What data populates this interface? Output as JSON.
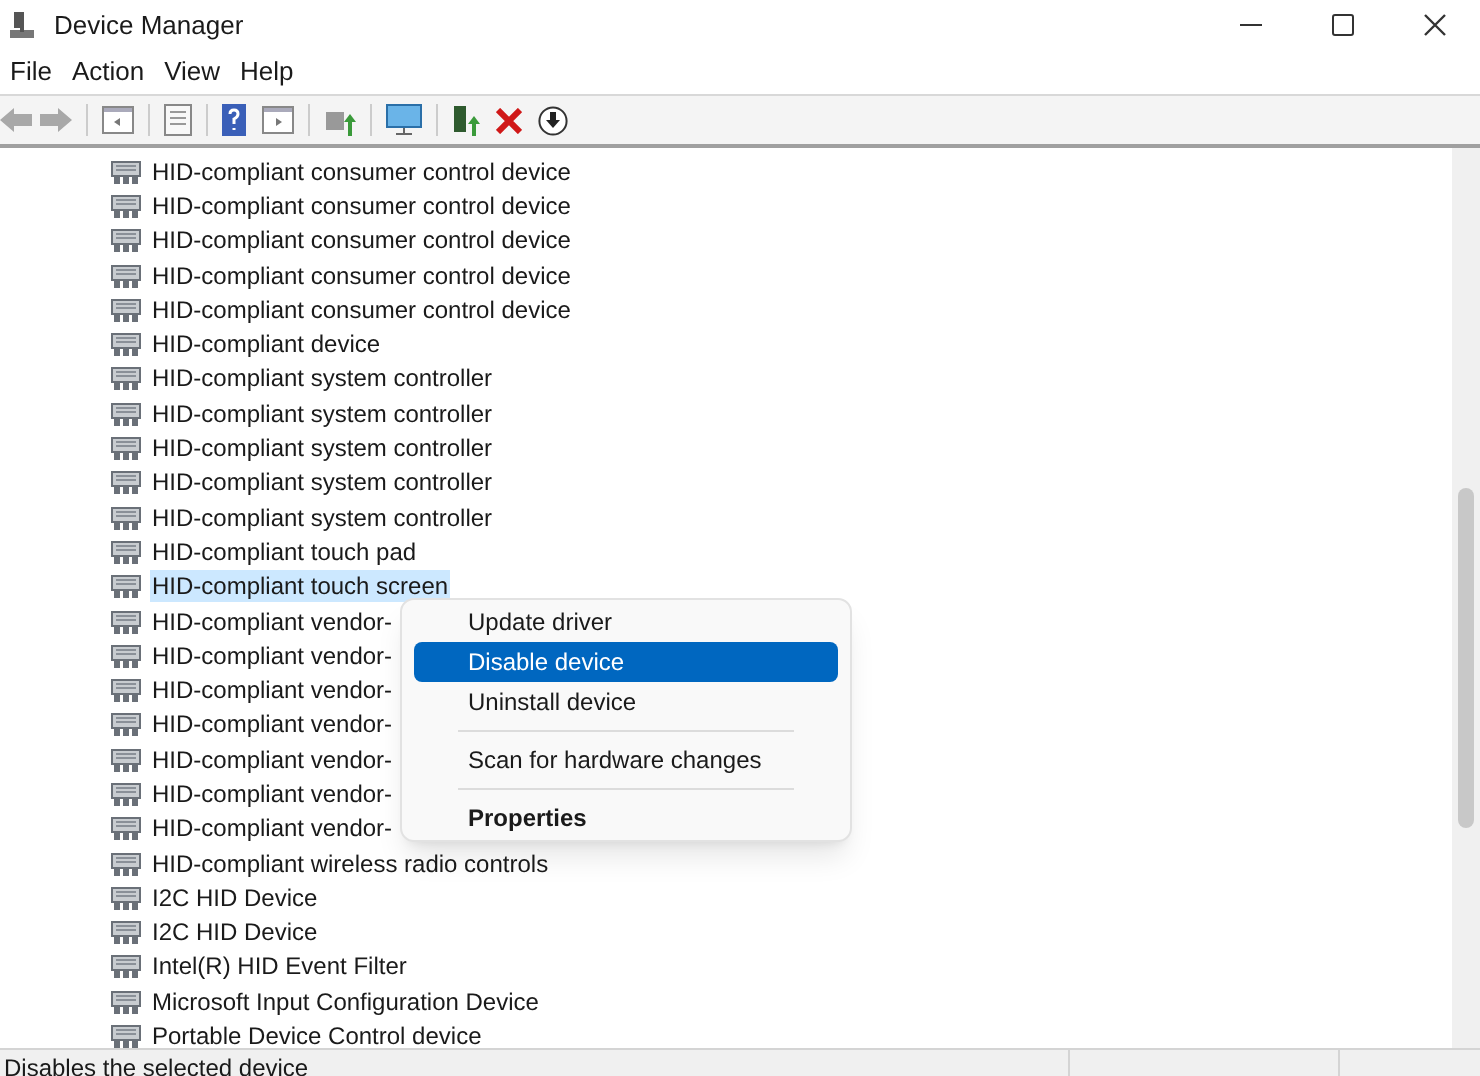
{
  "window": {
    "title": "Device Manager"
  },
  "menu_bar": [
    {
      "label": "File"
    },
    {
      "label": "Action"
    },
    {
      "label": "View"
    },
    {
      "label": "Help"
    }
  ],
  "devices": [
    {
      "label": "HID-compliant consumer control device",
      "selected": false
    },
    {
      "label": "HID-compliant consumer control device",
      "selected": false
    },
    {
      "label": "HID-compliant consumer control device",
      "selected": false
    },
    {
      "label": "HID-compliant consumer control device",
      "selected": false
    },
    {
      "label": "HID-compliant consumer control device",
      "selected": false
    },
    {
      "label": "HID-compliant device",
      "selected": false
    },
    {
      "label": "HID-compliant system controller",
      "selected": false
    },
    {
      "label": "HID-compliant system controller",
      "selected": false
    },
    {
      "label": "HID-compliant system controller",
      "selected": false
    },
    {
      "label": "HID-compliant system controller",
      "selected": false
    },
    {
      "label": "HID-compliant system controller",
      "selected": false
    },
    {
      "label": "HID-compliant touch pad",
      "selected": false
    },
    {
      "label": "HID-compliant touch screen",
      "selected": true
    },
    {
      "label": "HID-compliant vendor-",
      "selected": false
    },
    {
      "label": "HID-compliant vendor-",
      "selected": false
    },
    {
      "label": "HID-compliant vendor-",
      "selected": false
    },
    {
      "label": "HID-compliant vendor-",
      "selected": false
    },
    {
      "label": "HID-compliant vendor-",
      "selected": false
    },
    {
      "label": "HID-compliant vendor-",
      "selected": false
    },
    {
      "label": "HID-compliant vendor-",
      "selected": false
    },
    {
      "label": "HID-compliant wireless radio controls",
      "selected": false
    },
    {
      "label": "I2C HID Device",
      "selected": false
    },
    {
      "label": "I2C HID Device",
      "selected": false
    },
    {
      "label": "Intel(R) HID Event Filter",
      "selected": false
    },
    {
      "label": "Microsoft Input Configuration Device",
      "selected": false
    },
    {
      "label": "Portable Device Control device",
      "selected": false
    }
  ],
  "context_menu": [
    {
      "kind": "item",
      "label": "Update driver",
      "selected": false,
      "default": false
    },
    {
      "kind": "item",
      "label": "Disable device",
      "selected": true,
      "default": false
    },
    {
      "kind": "item",
      "label": "Uninstall device",
      "selected": false,
      "default": false
    },
    {
      "kind": "separator"
    },
    {
      "kind": "item",
      "label": "Scan for hardware changes",
      "selected": false,
      "default": false
    },
    {
      "kind": "separator"
    },
    {
      "kind": "item",
      "label": "Properties",
      "selected": false,
      "default": true
    }
  ],
  "status_bar": {
    "text": "Disables the selected device"
  }
}
